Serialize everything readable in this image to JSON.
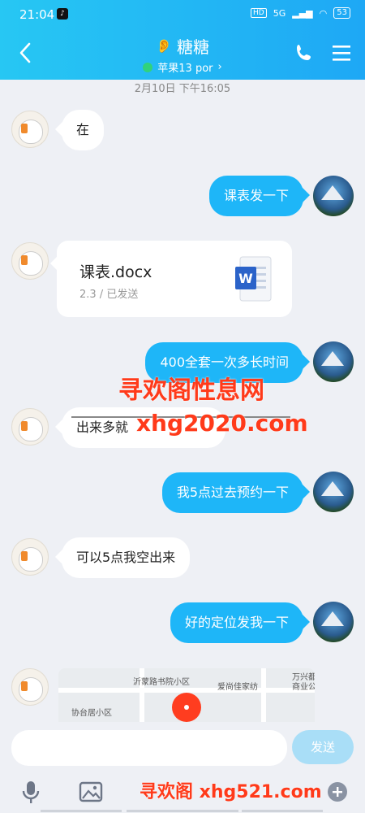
{
  "status": {
    "time": "21:04",
    "battery": "53",
    "net": "5G",
    "hd": "HD"
  },
  "header": {
    "title": "糖糖",
    "subtitle": "苹果13 por",
    "subtitle_chevron": "›"
  },
  "timestamp": "2月10日 下午16:05",
  "messages": [
    {
      "side": "left",
      "text": "在"
    },
    {
      "side": "right",
      "text": "课表发一下"
    },
    {
      "side": "left",
      "type": "file",
      "file_name": "课表.docx",
      "file_meta": "2.3 / 已发送"
    },
    {
      "side": "right",
      "text": "400全套一次多长时间"
    },
    {
      "side": "left",
      "text": "出来多就"
    },
    {
      "side": "right",
      "text": "我5点过去预约一下"
    },
    {
      "side": "left",
      "text": "可以5点我空出来"
    },
    {
      "side": "right",
      "text": "好的定位发我一下"
    },
    {
      "side": "left",
      "type": "map",
      "map_labels": [
        "沂蒙路书院小区",
        "爱尚佳家纺",
        "协台居小区",
        "万兴都",
        "商业公"
      ]
    }
  ],
  "watermarks": {
    "line1": "寻欢阁性息网",
    "line2": "xhg2020.com",
    "line3": "寻欢阁 xhg521.com"
  },
  "input": {
    "placeholder": "",
    "send_label": "发送"
  },
  "icons": [
    "back-icon",
    "hearing-icon",
    "phone-icon",
    "menu-icon",
    "mic-icon",
    "image-icon",
    "plus-icon"
  ],
  "colors": {
    "accent": "#1eb6f8",
    "header": "#1ea8f5",
    "watermark": "#ff3a1a"
  }
}
